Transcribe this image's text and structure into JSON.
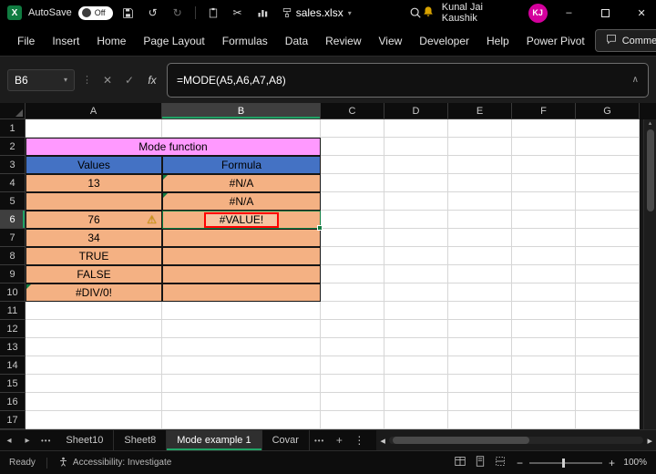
{
  "title_bar": {
    "app_icon_letter": "X",
    "autosave_label": "AutoSave",
    "autosave_state": "Off",
    "filename": "sales.xlsx",
    "user_name": "Kunal Jai Kaushik",
    "user_initials": "KJ"
  },
  "menu_bar": {
    "tabs": [
      "File",
      "Insert",
      "Home",
      "Page Layout",
      "Formulas",
      "Data",
      "Review",
      "View",
      "Developer",
      "Help",
      "Power Pivot"
    ],
    "comments_label": "Comments"
  },
  "formula_bar": {
    "name_box": "B6",
    "fx_label": "fx",
    "formula": "=MODE(A5,A6,A7,A8)"
  },
  "sheet": {
    "columns": [
      "A",
      "B",
      "C",
      "D",
      "E",
      "F",
      "G"
    ],
    "row_numbers": [
      "1",
      "2",
      "3",
      "4",
      "5",
      "6",
      "7",
      "8",
      "9",
      "10",
      "11",
      "12",
      "13",
      "14",
      "15",
      "16",
      "17"
    ],
    "selected_cell": "B6",
    "table": {
      "title": "Mode function",
      "col1_header": "Values",
      "col2_header": "Formula",
      "values": {
        "r4": "13",
        "r5": "",
        "r6": "76",
        "r7": "34",
        "r8": "TRUE",
        "r9": "FALSE",
        "r10": "#DIV/0!"
      },
      "formulas": {
        "r4": "#N/A",
        "r5": "#N/A",
        "r6": "#VALUE!",
        "r7": "",
        "r8": "",
        "r9": "",
        "r10": ""
      }
    }
  },
  "sheet_tabs": {
    "tabs": [
      "Sheet10",
      "Sheet8",
      "Mode example 1",
      "Covar"
    ],
    "active_tab": "Mode example 1"
  },
  "status_bar": {
    "mode": "Ready",
    "accessibility": "Accessibility: Investigate",
    "zoom_level": "100%"
  },
  "colors": {
    "title_pink": "#FF99FF",
    "header_blue": "#4472C4",
    "cell_peach": "#F4B183",
    "error_border_red": "#FF0000",
    "accent_green": "#21A366",
    "excel_green": "#107C41",
    "avatar_magenta": "#D4009D"
  },
  "icons": {
    "undo": "↺",
    "redo": "↻",
    "cut": "✂",
    "dropdown": "▾",
    "more_v": "⋮",
    "close": "✕",
    "minimize": "–",
    "cancel": "✕",
    "check": "✓",
    "collapse": "∧",
    "prev": "◂",
    "next": "▸",
    "up": "▴",
    "down": "▾",
    "ellipsis": "•••",
    "add": "+",
    "minus": "−",
    "plus": "+",
    "warning": "⚠",
    "pencil": "✎"
  }
}
